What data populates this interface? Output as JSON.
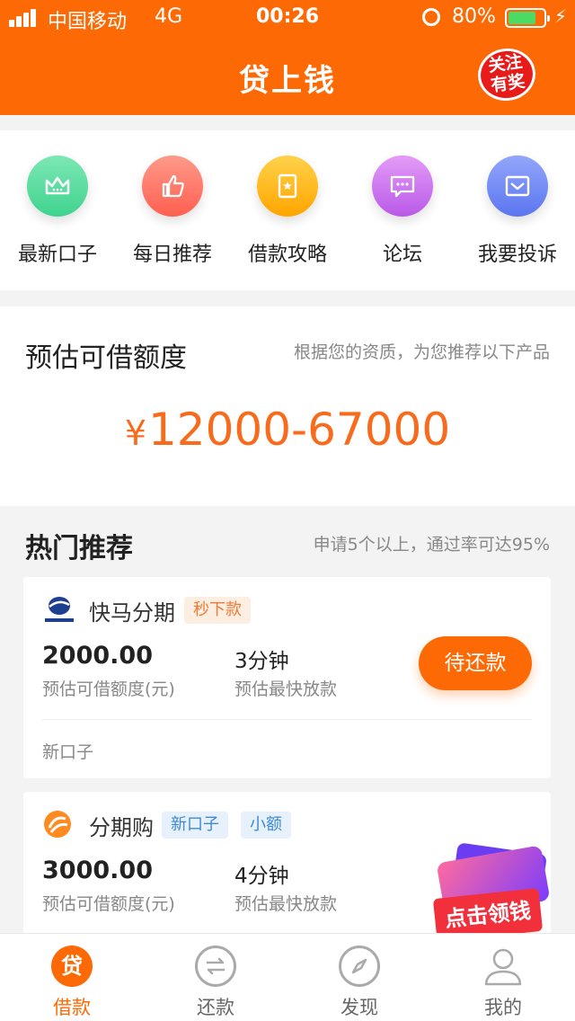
{
  "status_bar": {
    "carrier": "中国移动",
    "network": "4G",
    "time": "00:26",
    "battery": "80%"
  },
  "header": {
    "title": "贷上钱",
    "follow_badge_line1": "关注",
    "follow_badge_line2": "有奖"
  },
  "quick_menu": {
    "items": [
      {
        "label": "最新口子",
        "icon": "crown-icon",
        "color": "#3fd38f"
      },
      {
        "label": "每日推荐",
        "icon": "thumbs-up-icon",
        "color": "#ff6b5b"
      },
      {
        "label": "借款攻略",
        "icon": "guide-book-icon",
        "color": "#ffb20d"
      },
      {
        "label": "论坛",
        "icon": "chat-bubble-icon",
        "color": "#c86cf0"
      },
      {
        "label": "我要投诉",
        "icon": "mail-icon",
        "color": "#6c86f4"
      }
    ]
  },
  "credit": {
    "title": "预估可借额度",
    "hint": "根据您的资质，为您推荐以下产品",
    "currency": "¥",
    "range": "12000-67000"
  },
  "hot": {
    "title": "热门推荐",
    "hint": "申请5个以上，通过率可达95%"
  },
  "products": [
    {
      "name": "快马分期",
      "tags": [
        "秒下款"
      ],
      "amount": "2000.00",
      "amount_label": "预估可借额度(元)",
      "speed": "3分钟",
      "speed_label": "预估最快放款",
      "button": "待还款",
      "footer": "新口子"
    },
    {
      "name": "分期购",
      "tags": [
        "新口子",
        "小额"
      ],
      "amount": "3000.00",
      "amount_label": "预估可借额度(元)",
      "speed": "4分钟",
      "speed_label": "预估最快放款"
    }
  ],
  "promo": {
    "text": "点击领钱"
  },
  "tabbar": {
    "items": [
      {
        "label": "借款",
        "icon": "loan-icon",
        "active": true
      },
      {
        "label": "还款",
        "icon": "repay-icon",
        "active": false
      },
      {
        "label": "发现",
        "icon": "compass-icon",
        "active": false
      },
      {
        "label": "我的",
        "icon": "user-icon",
        "active": false
      }
    ]
  },
  "colors": {
    "brand_orange": "#fd6a05",
    "amount_orange": "#f86b1c"
  }
}
